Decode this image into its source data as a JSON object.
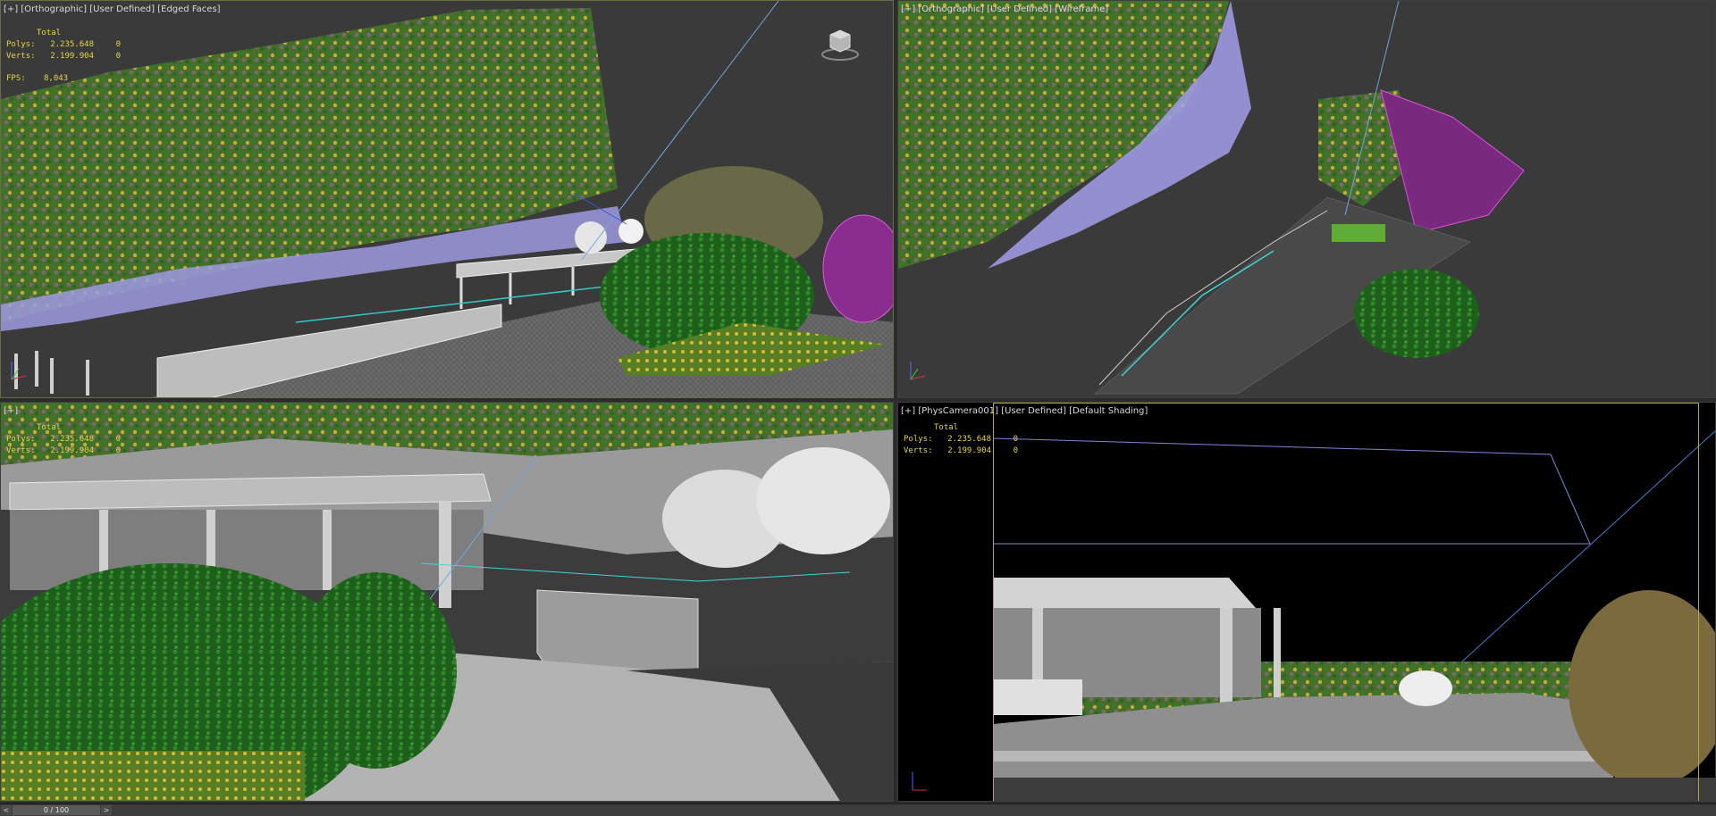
{
  "viewports": {
    "top_left": {
      "label": {
        "plus": "[+]",
        "view": "[Orthographic]",
        "mode": "[User Defined]",
        "shading": "[Edged Faces]"
      },
      "stats": {
        "header": "Total",
        "polys_label": "Polys:",
        "polys_value": "2.235.648",
        "polys_sel": "0",
        "verts_label": "Verts:",
        "verts_value": "2.199.904",
        "verts_sel": "0",
        "fps_label": "FPS:",
        "fps_value": "8,043"
      }
    },
    "top_right": {
      "label": {
        "plus": "[+]",
        "view": "[Orthographic]",
        "mode": "[User Defined]",
        "shading": "[Wireframe]"
      }
    },
    "bottom_left": {
      "label": {
        "plus": "[+]",
        "view": "",
        "mode": "",
        "shading": ""
      },
      "stats": {
        "header": "Total",
        "polys_label": "Polys:",
        "polys_value": "2.235.648",
        "polys_sel": "0",
        "verts_label": "Verts:",
        "verts_value": "2.199.904",
        "verts_sel": "0"
      }
    },
    "bottom_right": {
      "label": {
        "plus": "[+]",
        "view": "[PhysCamera001]",
        "mode": "[User Defined]",
        "shading": "[Default Shading]"
      },
      "stats": {
        "header": "Total",
        "polys_label": "Polys:",
        "polys_value": "2.235.648",
        "polys_sel": "0",
        "verts_label": "Verts:",
        "verts_value": "2.199.904",
        "verts_sel": "0"
      }
    }
  },
  "timeline": {
    "prev": "<",
    "frame": "0 / 100",
    "next": ">"
  },
  "colors": {
    "stats_text": "#e8d64a",
    "active_border": "#6b6b45",
    "camera_frame": "#b7a637",
    "wire_blue": "#6fa8dc"
  },
  "icons": {
    "viewcube": "viewcube-icon",
    "axis": "axis-tripod-icon"
  }
}
